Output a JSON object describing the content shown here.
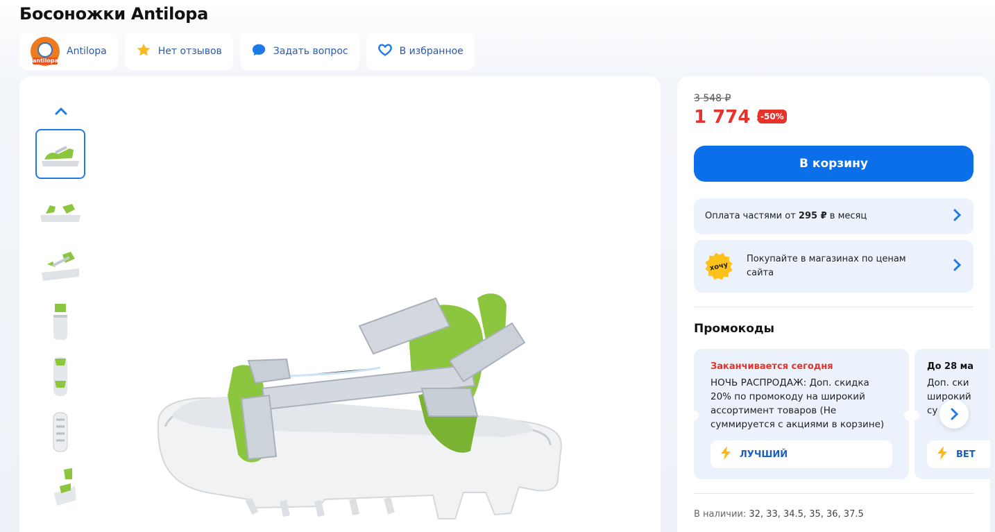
{
  "product": {
    "title": "Босоножки Antilopa"
  },
  "chips": {
    "brand": "Antilopa",
    "brand_logo_text": "antilopa",
    "reviews": "Нет отзывов",
    "question": "Задать вопрос",
    "favorite": "В избранное"
  },
  "price": {
    "old": "3 548 ₽",
    "current": "1 774 ₽",
    "discount": "-50%"
  },
  "cart_button": "В корзину",
  "installments": {
    "prefix": "Оплата частями от ",
    "amount": "295 ₽",
    "suffix": " в месяц"
  },
  "shops": {
    "badge": "хочу",
    "text": "Покупайте в магазинах по ценам сайта"
  },
  "promo": {
    "title": "Промокоды",
    "cards": [
      {
        "head": "Заканчивается сегодня",
        "desc": "НОЧЬ РАСПРОДАЖ: Доп. скидка 20% по промокоду на широкий ассортимент товаров (Не суммируется с акциями в корзине)",
        "tag": "ЛУЧШИЙ"
      },
      {
        "head": "До 28 ма",
        "desc": "Доп. ски широкий су у",
        "tag": "ВЕТ"
      }
    ]
  },
  "availability": {
    "label": "В наличии: ",
    "sizes": "32, 33, 34.5, 35, 36, 37.5"
  },
  "colors": {
    "accent": "#0a6fe8",
    "sale": "#e5322a",
    "shoe_green": "#8cc63f"
  }
}
